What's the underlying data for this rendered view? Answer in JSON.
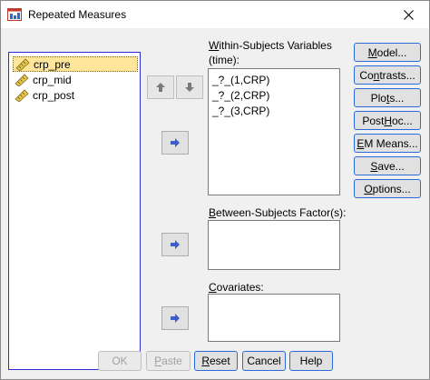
{
  "window": {
    "title": "Repeated Measures",
    "icons": {
      "app": "spss-dialog-icon",
      "close": "close-icon",
      "variable": "ruler-scale-icon"
    }
  },
  "variables": {
    "items": [
      {
        "label": "crp_pre",
        "selected": true
      },
      {
        "label": "crp_mid",
        "selected": false
      },
      {
        "label": "crp_post",
        "selected": false
      }
    ]
  },
  "within": {
    "label_pre": "",
    "label_key": "W",
    "label_rest": "ithin-Subjects Variables",
    "sublabel": "(time):",
    "items": [
      "_?_(1,CRP)",
      "_?_(2,CRP)",
      "_?_(3,CRP)"
    ]
  },
  "between": {
    "label_key": "B",
    "label_rest": "etween-Subjects Factor(s):"
  },
  "covariates": {
    "label_key": "C",
    "label_rest": "ovariates:"
  },
  "arrows": {
    "up": "arrow-up-icon",
    "down": "arrow-down-icon",
    "move": "arrow-right-icon"
  },
  "side_buttons": [
    {
      "pre": "",
      "key": "M",
      "post": "odel..."
    },
    {
      "pre": "Co",
      "key": "n",
      "post": "trasts..."
    },
    {
      "pre": "Plo",
      "key": "t",
      "post": "s..."
    },
    {
      "pre": "Post ",
      "key": "H",
      "post": "oc..."
    },
    {
      "pre": "",
      "key": "E",
      "post": "M Means..."
    },
    {
      "pre": "",
      "key": "S",
      "post": "ave..."
    },
    {
      "pre": "",
      "key": "O",
      "post": "ptions..."
    }
  ],
  "bottom_buttons": [
    {
      "pre": "OK",
      "key": "",
      "post": "",
      "disabled": true
    },
    {
      "pre": "",
      "key": "P",
      "post": "aste",
      "disabled": true
    },
    {
      "pre": "",
      "key": "R",
      "post": "eset",
      "disabled": false
    },
    {
      "pre": "Cancel",
      "key": "",
      "post": "",
      "disabled": false
    },
    {
      "pre": "Help",
      "key": "",
      "post": "",
      "disabled": false
    }
  ],
  "colors": {
    "focus_border": "#2b6ad8",
    "selection": "#ffe69a",
    "arrow_blue": "#3a5fc8"
  }
}
